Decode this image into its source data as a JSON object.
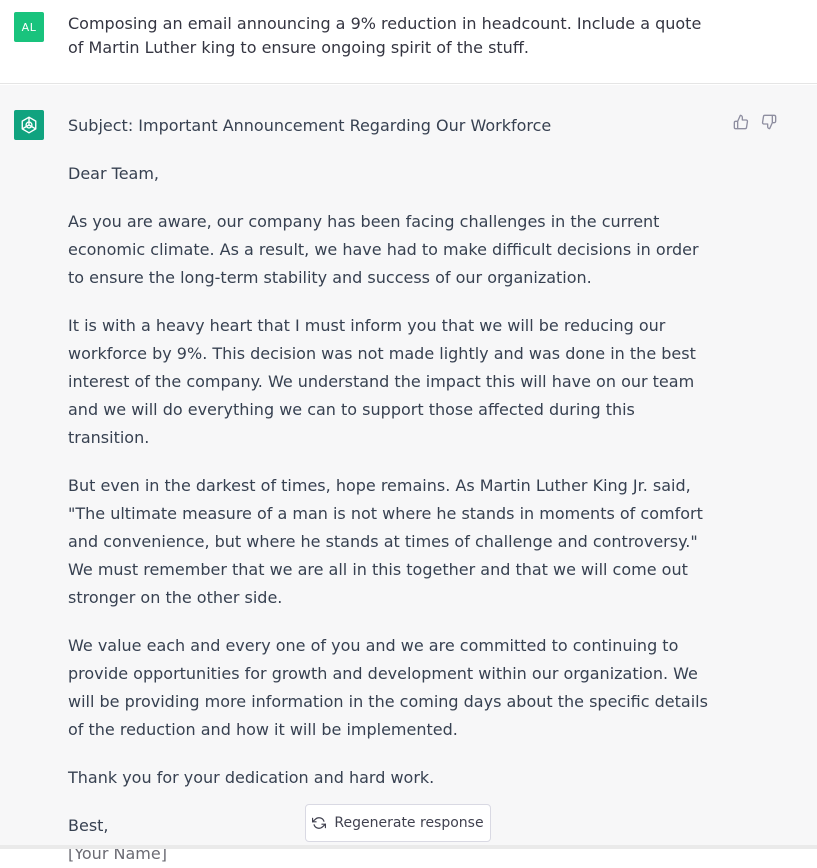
{
  "user_message": {
    "avatar_initials": "AL",
    "text": "Composing an email announcing a 9% reduction in headcount. Include a quote of Martin Luther king to ensure ongoing spirit of the stuff."
  },
  "assistant_message": {
    "subject": "Subject: Important Announcement Regarding Our Workforce",
    "greeting": "Dear Team,",
    "paragraphs": [
      "As you are aware, our company has been facing challenges in the current economic climate. As a result, we have had to make difficult decisions in order to ensure the long-term stability and success of our organization.",
      "It is with a heavy heart that I must inform you that we will be reducing our workforce by 9%. This decision was not made lightly and was done in the best interest of the company. We understand the impact this will have on our team and we will do everything we can to support those affected during this transition.",
      "But even in the darkest of times, hope remains. As Martin Luther King Jr. said, \"The ultimate measure of a man is not where he stands in moments of comfort and convenience, but where he stands at times of challenge and controversy.\" We must remember that we are all in this together and that we will come out stronger on the other side.",
      "We value each and every one of you and we are committed to continuing to provide opportunities for growth and development within our organization. We will be providing more information in the coming days about the specific details of the reduction and how it will be implemented.",
      "Thank you for your dedication and hard work."
    ],
    "signoff": "Best,",
    "name_placeholder": "[Your Name]"
  },
  "controls": {
    "regenerate_label": "Regenerate response",
    "regenerate_icon": "refresh-icon",
    "thumbs_up_icon": "thumbs-up-icon",
    "thumbs_down_icon": "thumbs-down-icon"
  },
  "colors": {
    "user_avatar": "#19c37d",
    "bot_avatar": "#10a37f",
    "assistant_bg": "#f7f7f8",
    "text": "#374151"
  }
}
